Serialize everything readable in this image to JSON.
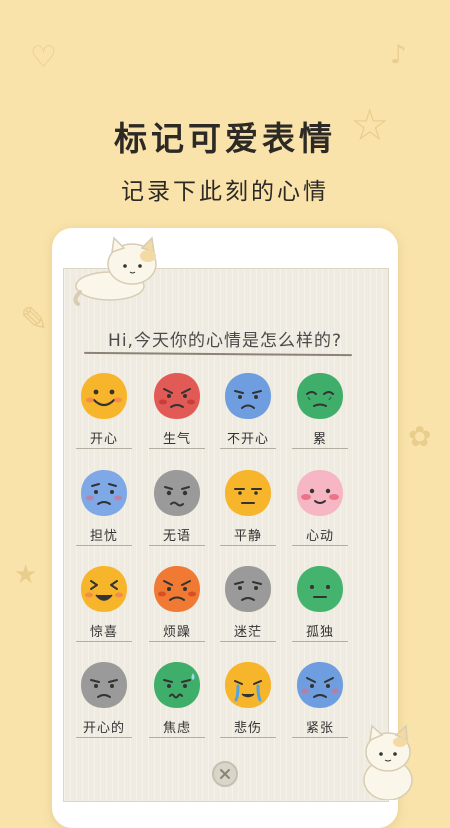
{
  "header": {
    "title": "标记可爱表情",
    "subtitle": "记录下此刻的心情"
  },
  "prompt": {
    "question": "Hi,今天你的心情是怎么样的?"
  },
  "moods": [
    {
      "label": "开心",
      "color": "#f7b52c",
      "icon": "happy-face-icon"
    },
    {
      "label": "生气",
      "color": "#e25a55",
      "icon": "angry-face-icon"
    },
    {
      "label": "不开心",
      "color": "#6f9ee0",
      "icon": "unhappy-face-icon"
    },
    {
      "label": "累",
      "color": "#3fae6a",
      "icon": "tired-face-icon"
    },
    {
      "label": "担忧",
      "color": "#7fa9e6",
      "icon": "worried-face-icon"
    },
    {
      "label": "无语",
      "color": "#9a9a9a",
      "icon": "speechless-face-icon"
    },
    {
      "label": "平静",
      "color": "#f7b52c",
      "icon": "calm-face-icon"
    },
    {
      "label": "心动",
      "color": "#f7b6c3",
      "icon": "crush-face-icon"
    },
    {
      "label": "惊喜",
      "color": "#f7b52c",
      "icon": "surprised-face-icon"
    },
    {
      "label": "烦躁",
      "color": "#f07a34",
      "icon": "irritated-face-icon"
    },
    {
      "label": "迷茫",
      "color": "#9a9a9a",
      "icon": "confused-face-icon"
    },
    {
      "label": "孤独",
      "color": "#43b36e",
      "icon": "lonely-face-icon"
    },
    {
      "label": "开心的",
      "color": "#9a9a9a",
      "icon": "sad-smile-face-icon"
    },
    {
      "label": "焦虑",
      "color": "#3fae6a",
      "icon": "anxious-face-icon"
    },
    {
      "label": "悲伤",
      "color": "#f7b52c",
      "icon": "crying-face-icon"
    },
    {
      "label": "紧张",
      "color": "#6f9ee0",
      "icon": "nervous-face-icon"
    }
  ],
  "close": {
    "icon": "close-icon"
  }
}
